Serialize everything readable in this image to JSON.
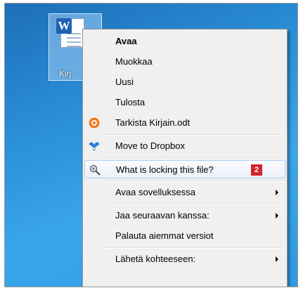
{
  "desktop": {
    "file_icon_label": "Kirj"
  },
  "context_menu": {
    "items": [
      {
        "label": "Avaa"
      },
      {
        "label": "Muokkaa"
      },
      {
        "label": "Uusi"
      },
      {
        "label": "Tulosta"
      },
      {
        "label": "Tarkista Kirjain.odt",
        "icon": "avast-icon"
      },
      {
        "label": "Move to Dropbox",
        "icon": "dropbox-icon"
      },
      {
        "label": "What is locking this file?",
        "icon": "magnifier-gear-icon",
        "badge": "2"
      },
      {
        "label": "Avaa sovelluksessa",
        "submenu": true
      },
      {
        "label": "Jaa seuraavan kanssa:",
        "submenu": true
      },
      {
        "label": "Palauta aiemmat versiot"
      },
      {
        "label": "Lähetä kohteeseen:",
        "submenu": true
      }
    ]
  },
  "colors": {
    "menu_background": "#f0f0f0",
    "hover_border": "#aecff7",
    "badge_red": "#d3232b"
  }
}
